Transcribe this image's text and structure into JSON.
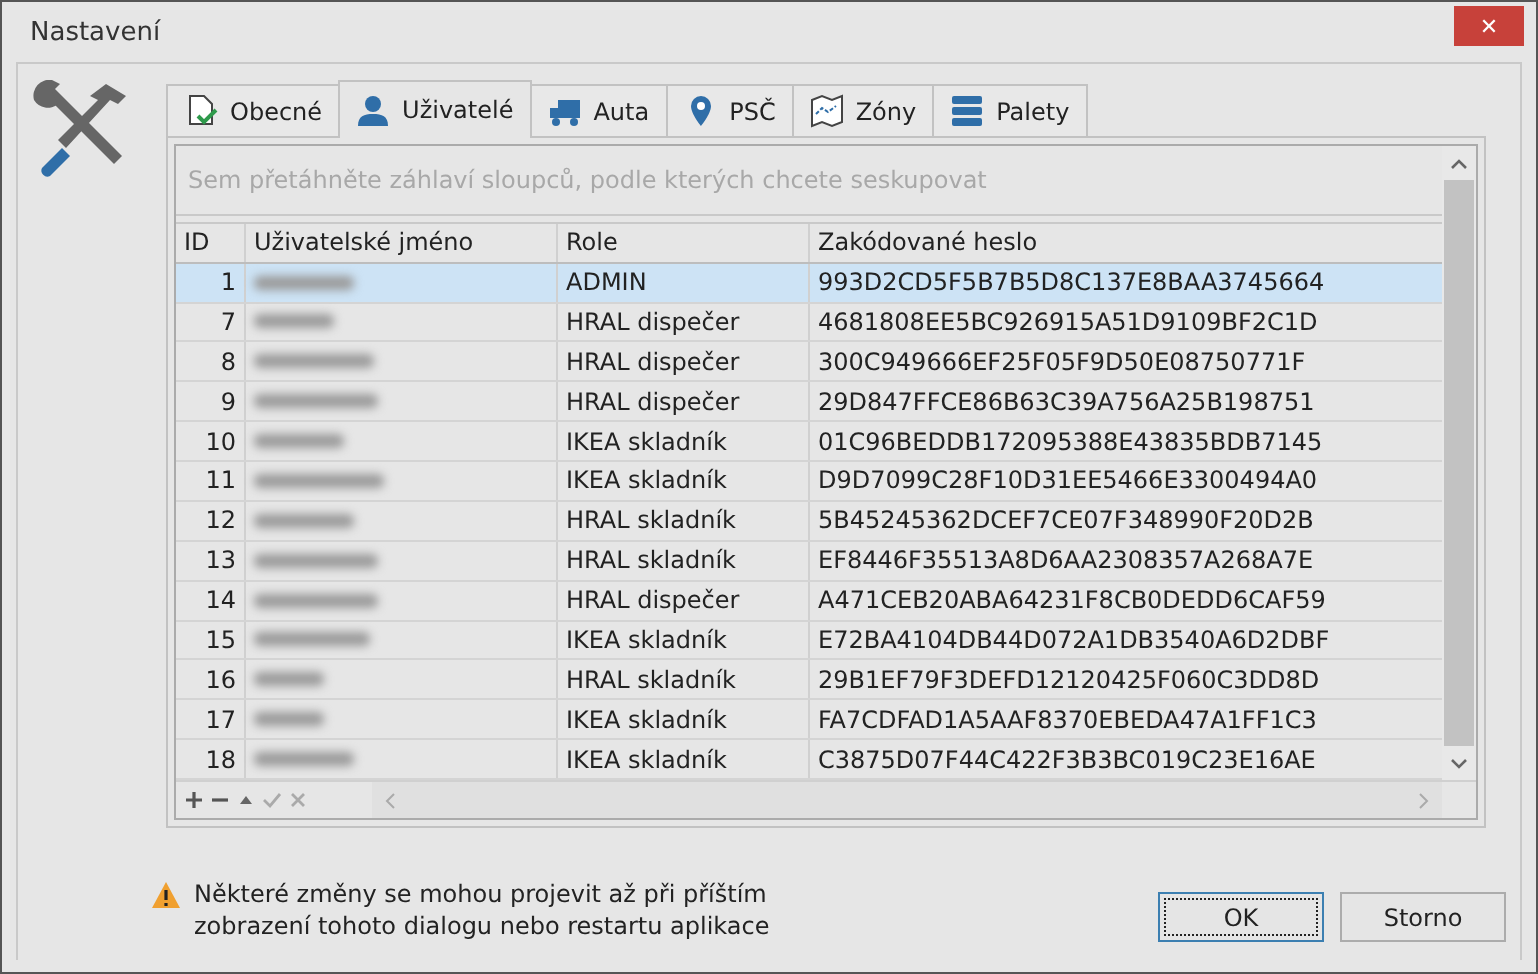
{
  "window": {
    "title": "Nastavení",
    "close": "✕"
  },
  "tabs": [
    {
      "label": "Obecné",
      "kind": "doc",
      "selected": false
    },
    {
      "label": "Uživatelé",
      "kind": "user",
      "selected": true
    },
    {
      "label": "Auta",
      "kind": "truck",
      "selected": false
    },
    {
      "label": "PSČ",
      "kind": "pin",
      "selected": false
    },
    {
      "label": "Zóny",
      "kind": "map",
      "selected": false
    },
    {
      "label": "Palety",
      "kind": "stack",
      "selected": false
    }
  ],
  "grid": {
    "group_panel_hint": "Sem přetáhněte záhlaví sloupců, podle kterých chcete seskupovat",
    "columns": [
      "ID",
      "Uživatelské jméno",
      "Role",
      "Zakódované heslo"
    ],
    "rows": [
      {
        "id": "1",
        "role": "ADMIN",
        "password": "993D2CD5F5B7B5D8C137E8BAA3745664",
        "selected": true
      },
      {
        "id": "7",
        "role": "HRAL dispečer",
        "password": "4681808EE5BC926915A51D9109BF2C1D",
        "selected": false
      },
      {
        "id": "8",
        "role": "HRAL dispečer",
        "password": "300C949666EF25F05F9D50E08750771F",
        "selected": false
      },
      {
        "id": "9",
        "role": "HRAL dispečer",
        "password": "29D847FFCE86B63C39A756A25B198751",
        "selected": false
      },
      {
        "id": "10",
        "role": "IKEA skladník",
        "password": "01C96BEDDB172095388E43835BDB7145",
        "selected": false
      },
      {
        "id": "11",
        "role": "IKEA skladník",
        "password": "D9D7099C28F10D31EE5466E3300494A0",
        "selected": false
      },
      {
        "id": "12",
        "role": "HRAL skladník",
        "password": "5B45245362DCEF7CE07F348990F20D2B",
        "selected": false
      },
      {
        "id": "13",
        "role": "HRAL skladník",
        "password": "EF8446F35513A8D6AA2308357A268A7E",
        "selected": false
      },
      {
        "id": "14",
        "role": "HRAL dispečer",
        "password": "A471CEB20ABA64231F8CB0DEDD6CAF59",
        "selected": false
      },
      {
        "id": "15",
        "role": "IKEA skladník",
        "password": "E72BA4104DB44D072A1DB3540A6D2DBF",
        "selected": false
      },
      {
        "id": "16",
        "role": "HRAL skladník",
        "password": "29B1EF79F3DEFD12120425F060C3DD8D",
        "selected": false
      },
      {
        "id": "17",
        "role": "IKEA skladník",
        "password": "FA7CDFAD1A5AAF8370EBEDA47A1FF1C3",
        "selected": false
      },
      {
        "id": "18",
        "role": "IKEA skladník",
        "password": "C3875D07F44C422F3B3BC019C23E16AE",
        "selected": false
      }
    ]
  },
  "warning": "Některé změny se mohou projevit až při příštím zobrazení tohoto dialogu nebo restartu aplikace",
  "buttons": [
    {
      "label": "OK",
      "selected": true
    },
    {
      "label": "Storno",
      "selected": false
    }
  ]
}
